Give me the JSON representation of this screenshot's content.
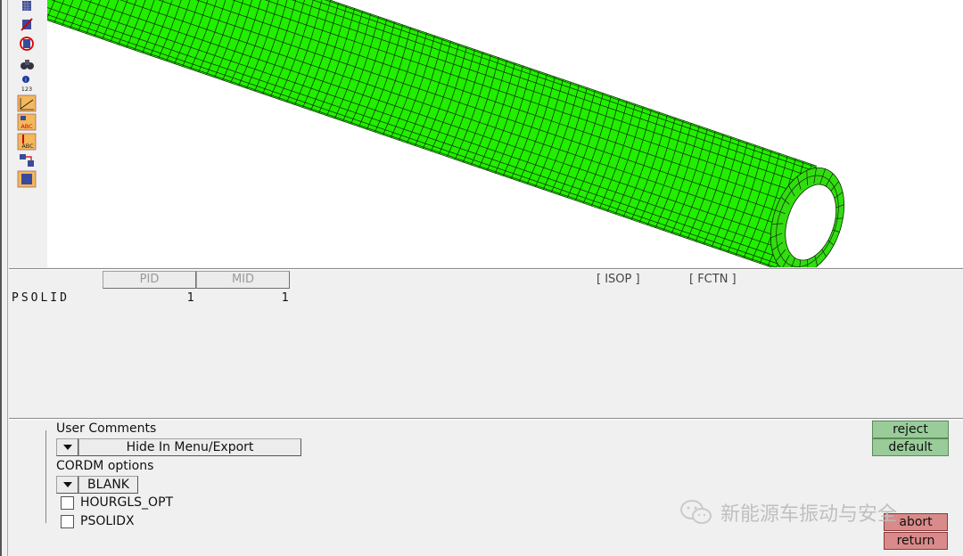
{
  "toolbar": {
    "icons": [
      "element-table-icon",
      "section-cut-icon",
      "no-entry-icon",
      "binoculars-icon",
      "info-123-icon",
      "distance-plot-icon",
      "label-abc-icon",
      "vertical-label-abc-icon",
      "transform-icon",
      "image-icon"
    ],
    "info_text": "123",
    "label_text": "ABC"
  },
  "viewport": {
    "mesh_color": "#22ee00",
    "edge_color": "#0a2a00"
  },
  "card": {
    "headers": [
      "PID",
      "MID",
      "[ ISOP ]",
      "[ FCTN ]"
    ],
    "name": "PSOLID",
    "pid": "1",
    "mid": "1"
  },
  "options": {
    "user_comments_label": "User Comments",
    "hide_option": "Hide In Menu/Export",
    "cordm_label": "CORDM options",
    "cordm_value": "BLANK",
    "checkboxes": [
      "HOURGLS_OPT",
      "PSOLIDX"
    ]
  },
  "buttons": {
    "reject": "reject",
    "default": "default",
    "abort": "abort",
    "return": "return"
  },
  "watermark": {
    "text": "新能源车振动与安全"
  }
}
